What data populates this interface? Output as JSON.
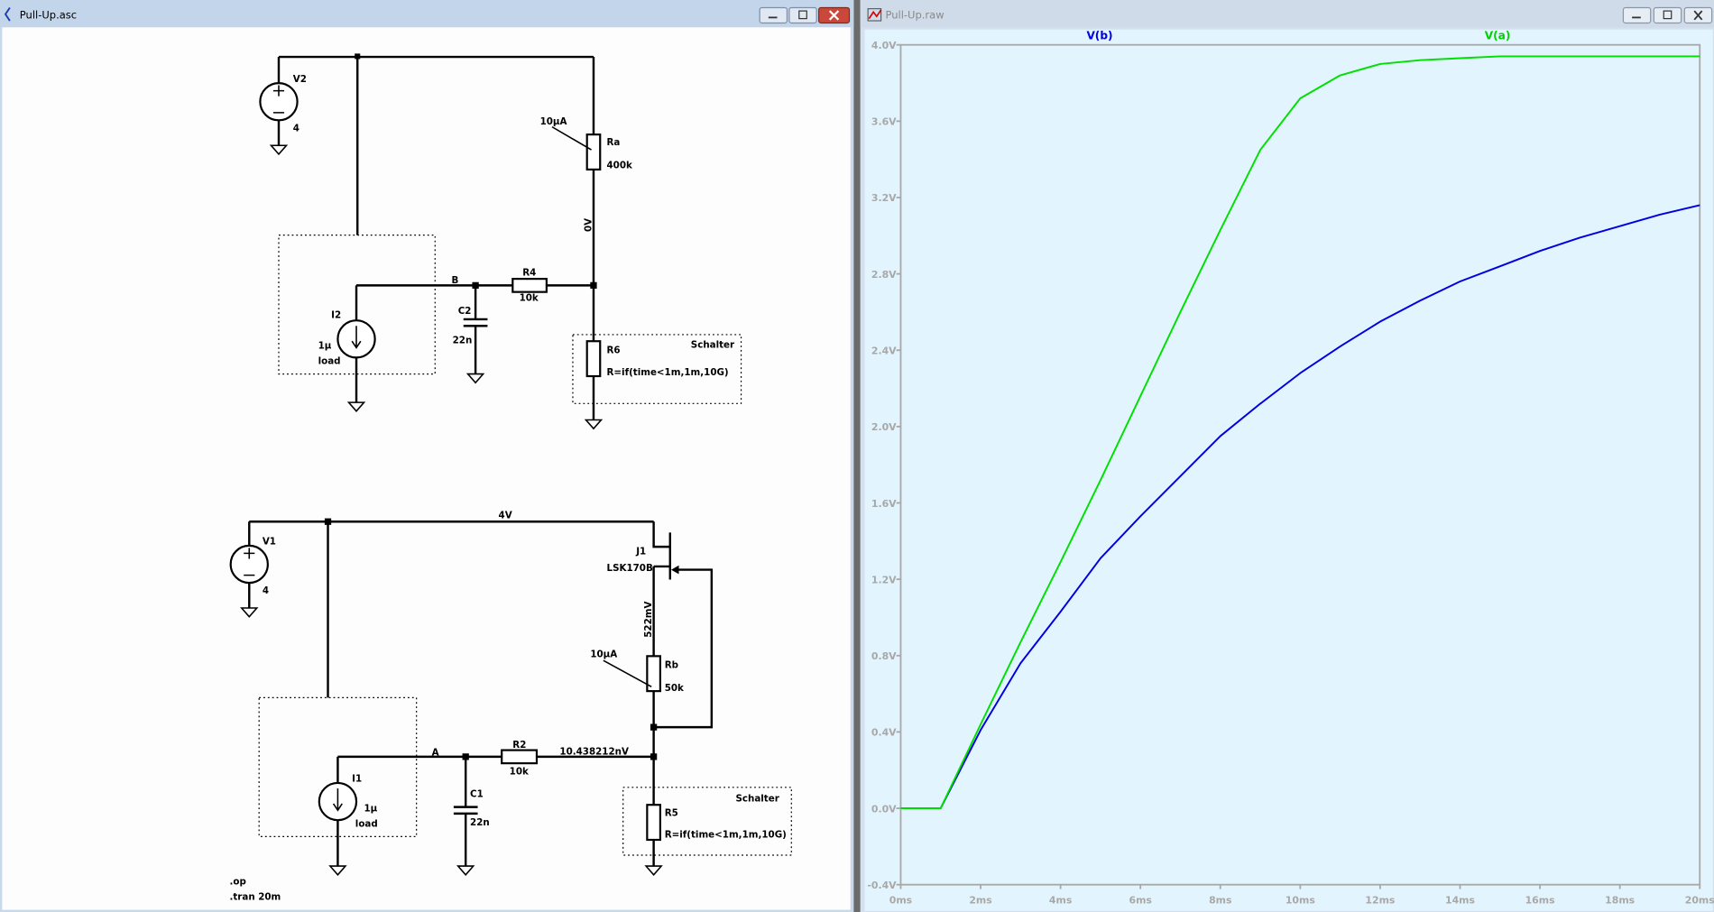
{
  "schematic_window": {
    "title": "Pull-Up.asc",
    "buttons": [
      "minimize",
      "restore",
      "close"
    ]
  },
  "waveform_window": {
    "title": "Pull-Up.raw",
    "buttons": [
      "minimize",
      "restore",
      "close"
    ]
  },
  "schematic": {
    "top": {
      "v2": {
        "name": "V2",
        "value": "4"
      },
      "i2": {
        "name": "I2",
        "value": "1µ",
        "label": "load"
      },
      "node_b": "B",
      "c2": {
        "name": "C2",
        "value": "22n"
      },
      "r4": {
        "name": "R4",
        "value": "10k"
      },
      "ra": {
        "name": "Ra",
        "value": "400k",
        "current": "10µA"
      },
      "voltage_label": "0V",
      "r6": {
        "name": "R6",
        "value": "R=if(time<1m,1m,10G)"
      },
      "switch_label": "Schalter"
    },
    "bottom": {
      "v1": {
        "name": "V1",
        "value": "4"
      },
      "rail_label": "4V",
      "i1": {
        "name": "I1",
        "value": "1µ",
        "label": "load"
      },
      "node_a": "A",
      "c1": {
        "name": "C1",
        "value": "22n"
      },
      "r2": {
        "name": "R2",
        "value": "10k"
      },
      "node_voltage": "10.438212nV",
      "j1": {
        "name": "J1",
        "model": "LSK170B"
      },
      "source_voltage": "522mV",
      "rb": {
        "name": "Rb",
        "value": "50k",
        "current": "10µA"
      },
      "r5": {
        "name": "R5",
        "value": "R=if(time<1m,1m,10G)"
      },
      "switch_label": "Schalter"
    },
    "directives": [
      ".op",
      ".tran 20m"
    ]
  },
  "chart_data": {
    "type": "line",
    "x": [
      0,
      1,
      2,
      3,
      4,
      5,
      6,
      7,
      8,
      9,
      10,
      11,
      12,
      13,
      14,
      15,
      16,
      17,
      18,
      19,
      20
    ],
    "series": [
      {
        "name": "V(b)",
        "color": "#0000e0",
        "values": [
          0,
          0,
          0.41,
          0.76,
          1.03,
          1.31,
          1.53,
          1.74,
          1.95,
          2.12,
          2.28,
          2.42,
          2.55,
          2.66,
          2.76,
          2.84,
          2.92,
          2.99,
          3.05,
          3.11,
          3.16
        ]
      },
      {
        "name": "V(a)",
        "color": "#00e000",
        "values": [
          0,
          0,
          0.44,
          0.87,
          1.29,
          1.72,
          2.16,
          2.6,
          3.03,
          3.45,
          3.72,
          3.84,
          3.9,
          3.92,
          3.93,
          3.94,
          3.94,
          3.94,
          3.94,
          3.94,
          3.94
        ]
      }
    ],
    "xlim": [
      0,
      20
    ],
    "ylim": [
      -0.4,
      4.0
    ],
    "xticks": [
      "0ms",
      "2ms",
      "4ms",
      "6ms",
      "8ms",
      "10ms",
      "12ms",
      "14ms",
      "16ms",
      "18ms",
      "20ms"
    ],
    "yticks": [
      "4.0V",
      "3.6V",
      "3.2V",
      "2.8V",
      "2.4V",
      "2.0V",
      "1.6V",
      "1.2V",
      "0.8V",
      "0.4V",
      "0.0V",
      "-0.4V"
    ],
    "background": "#e2f4fd",
    "grid": false,
    "legend": "top"
  }
}
